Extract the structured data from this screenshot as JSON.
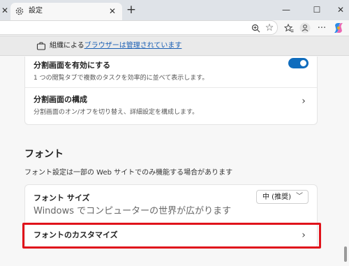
{
  "tab": {
    "title": "設定"
  },
  "infobar": {
    "prefix": "組織による",
    "link": "ブラウザーは管理されています"
  },
  "card1": {
    "row1": {
      "title": "分割画面を有効にする",
      "desc": "1 つの閲覧タブで複数のタスクを効率的に並べて表示します。",
      "toggle_on": true
    },
    "row2": {
      "title": "分割画面の構成",
      "desc": "分割画面のオン/オフを切り替え、詳細設定を構成します。"
    }
  },
  "fonts": {
    "title": "フォント",
    "desc": "フォント設定は一部の Web サイトでのみ機能する場合があります",
    "size_label": "フォント サイズ",
    "size_value": "中 (推奨)",
    "sample": "Windows でコンピューターの世界が広がります",
    "customize_label": "フォントのカスタマイズ"
  },
  "colors": {
    "accent": "#0f6cbd",
    "highlight": "#e0131b"
  },
  "icons": [
    "gear-icon",
    "close-icon",
    "plus-icon",
    "minimize-icon",
    "maximize-icon",
    "zoom-icon",
    "favorite-star-icon",
    "favorites-icon",
    "profile-icon",
    "more-icon",
    "copilot-icon",
    "briefcase-icon",
    "chevron-right-icon",
    "chevron-down-icon"
  ]
}
